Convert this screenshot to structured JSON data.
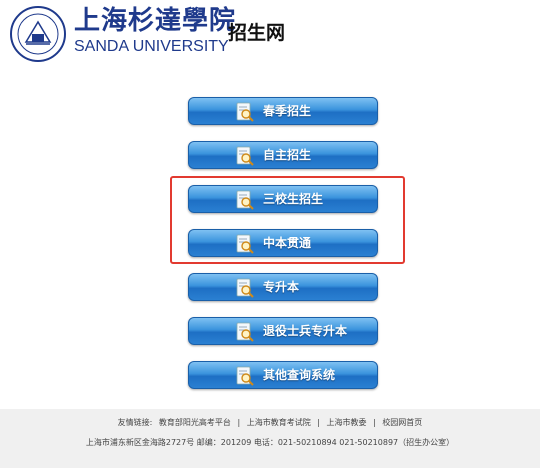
{
  "header": {
    "school_name_cn": "上海杉達學院",
    "school_name_en": "SANDA UNIVERSITY",
    "portal_title": "招生网",
    "logo_icon": "university-seal-icon"
  },
  "buttons": [
    {
      "label": "春季招生",
      "icon": "search-document-icon"
    },
    {
      "label": "自主招生",
      "icon": "search-document-icon"
    },
    {
      "label": "三校生招生",
      "icon": "search-document-icon"
    },
    {
      "label": "中本贯通",
      "icon": "search-document-icon"
    },
    {
      "label": "专升本",
      "icon": "search-document-icon"
    },
    {
      "label": "退役士兵专升本",
      "icon": "search-document-icon"
    },
    {
      "label": "其他查询系统",
      "icon": "search-document-icon"
    }
  ],
  "footer": {
    "links_prefix": "友情链接:",
    "links": [
      "教育部阳光高考平台",
      "上海市教育考试院",
      "上海市教委",
      "校园网首页"
    ],
    "separator": "|",
    "address": "上海市浦东新区金海路2727号 邮编：201209 电话：021-50210894 021-50210897（招生办公室）"
  },
  "colors": {
    "brand_blue": "#1f3a8c",
    "button_blue": "#2a80d2",
    "highlight_red": "#e23a30",
    "footer_bg": "#f0f0f0"
  }
}
